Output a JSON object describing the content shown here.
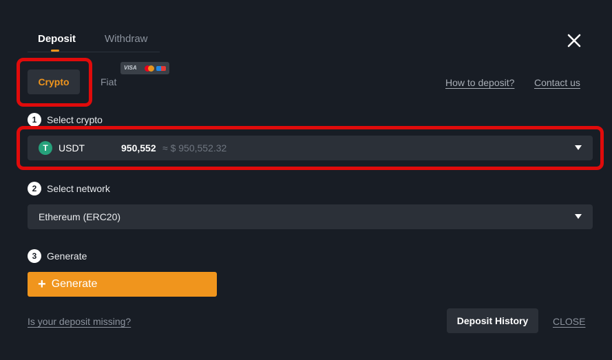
{
  "tabs": {
    "deposit": "Deposit",
    "withdraw": "Withdraw"
  },
  "method": {
    "crypto": "Crypto",
    "fiat": "Fiat",
    "card_visa": "VISA"
  },
  "links": {
    "how_to_deposit": "How to deposit?",
    "contact_us": "Contact us"
  },
  "steps": [
    {
      "num": "1",
      "label": "Select crypto"
    },
    {
      "num": "2",
      "label": "Select network"
    },
    {
      "num": "3",
      "label": "Generate"
    }
  ],
  "crypto_select": {
    "icon_glyph": "T",
    "coin": "USDT",
    "amount": "950,552",
    "approx": "≈ $ 950,552.32"
  },
  "network_select": {
    "value": "Ethereum (ERC20)"
  },
  "generate": {
    "plus": "+",
    "label": "Generate"
  },
  "footer": {
    "missing": "Is your deposit missing?",
    "history": "Deposit History",
    "close": "CLOSE"
  },
  "colors": {
    "accent": "#f0951d",
    "highlight": "#e00b0b",
    "background": "#181d25",
    "tether": "#26a17b"
  },
  "icons": {
    "close": "close-icon",
    "coin": "tether-icon",
    "dropdown": "chevron-down-icon"
  }
}
